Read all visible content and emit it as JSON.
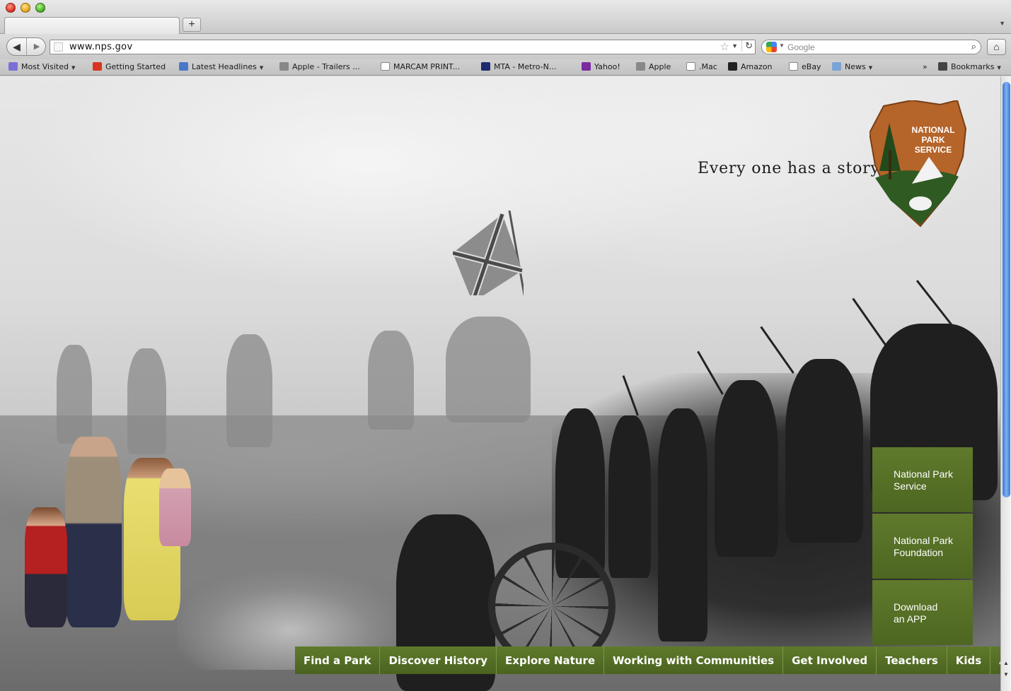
{
  "browser": {
    "new_tab_symbol": "+",
    "url": "www.nps.gov",
    "search_placeholder": "Google",
    "bookmarks": [
      {
        "label": "Most Visited",
        "icon": "smart-folder-icon",
        "menu": true
      },
      {
        "label": "Getting Started",
        "icon": "firefox-icon",
        "menu": false
      },
      {
        "label": "Latest Headlines",
        "icon": "rss-feed-icon",
        "menu": true
      },
      {
        "label": "Apple - Trailers ...",
        "icon": "apple-icon",
        "menu": false
      },
      {
        "label": "MARCAM PRINT...",
        "icon": "page-icon",
        "menu": false
      },
      {
        "label": "MTA - Metro-N...",
        "icon": "mta-icon",
        "menu": false
      },
      {
        "label": "Yahoo!",
        "icon": "yahoo-icon",
        "menu": false
      },
      {
        "label": "Apple",
        "icon": "apple-icon",
        "menu": false
      },
      {
        "label": ".Mac",
        "icon": "page-icon",
        "menu": false
      },
      {
        "label": "Amazon",
        "icon": "amazon-icon",
        "menu": false
      },
      {
        "label": "eBay",
        "icon": "page-icon",
        "menu": false
      },
      {
        "label": "News",
        "icon": "folder-icon",
        "menu": true
      }
    ],
    "overflow_symbol": "»",
    "bookmarks_menu": "Bookmarks"
  },
  "page": {
    "tagline": "Every one has a story.",
    "logo": {
      "line1": "NATIONAL",
      "line2": "PARK",
      "line3": "SERVICE"
    },
    "side_panels": [
      {
        "line1": "National Park",
        "line2": "Service"
      },
      {
        "line1": "National Park",
        "line2": "Foundation"
      },
      {
        "line1": "Download",
        "line2": "an APP"
      }
    ],
    "nav": [
      "Find a Park",
      "Discover History",
      "Explore Nature",
      "Working with Communities",
      "Get Involved",
      "Teachers",
      "Kids",
      "About Us"
    ],
    "colors": {
      "nav_green": "#587127",
      "logo_brown": "#b5642a",
      "logo_green": "#2f5a22"
    }
  }
}
